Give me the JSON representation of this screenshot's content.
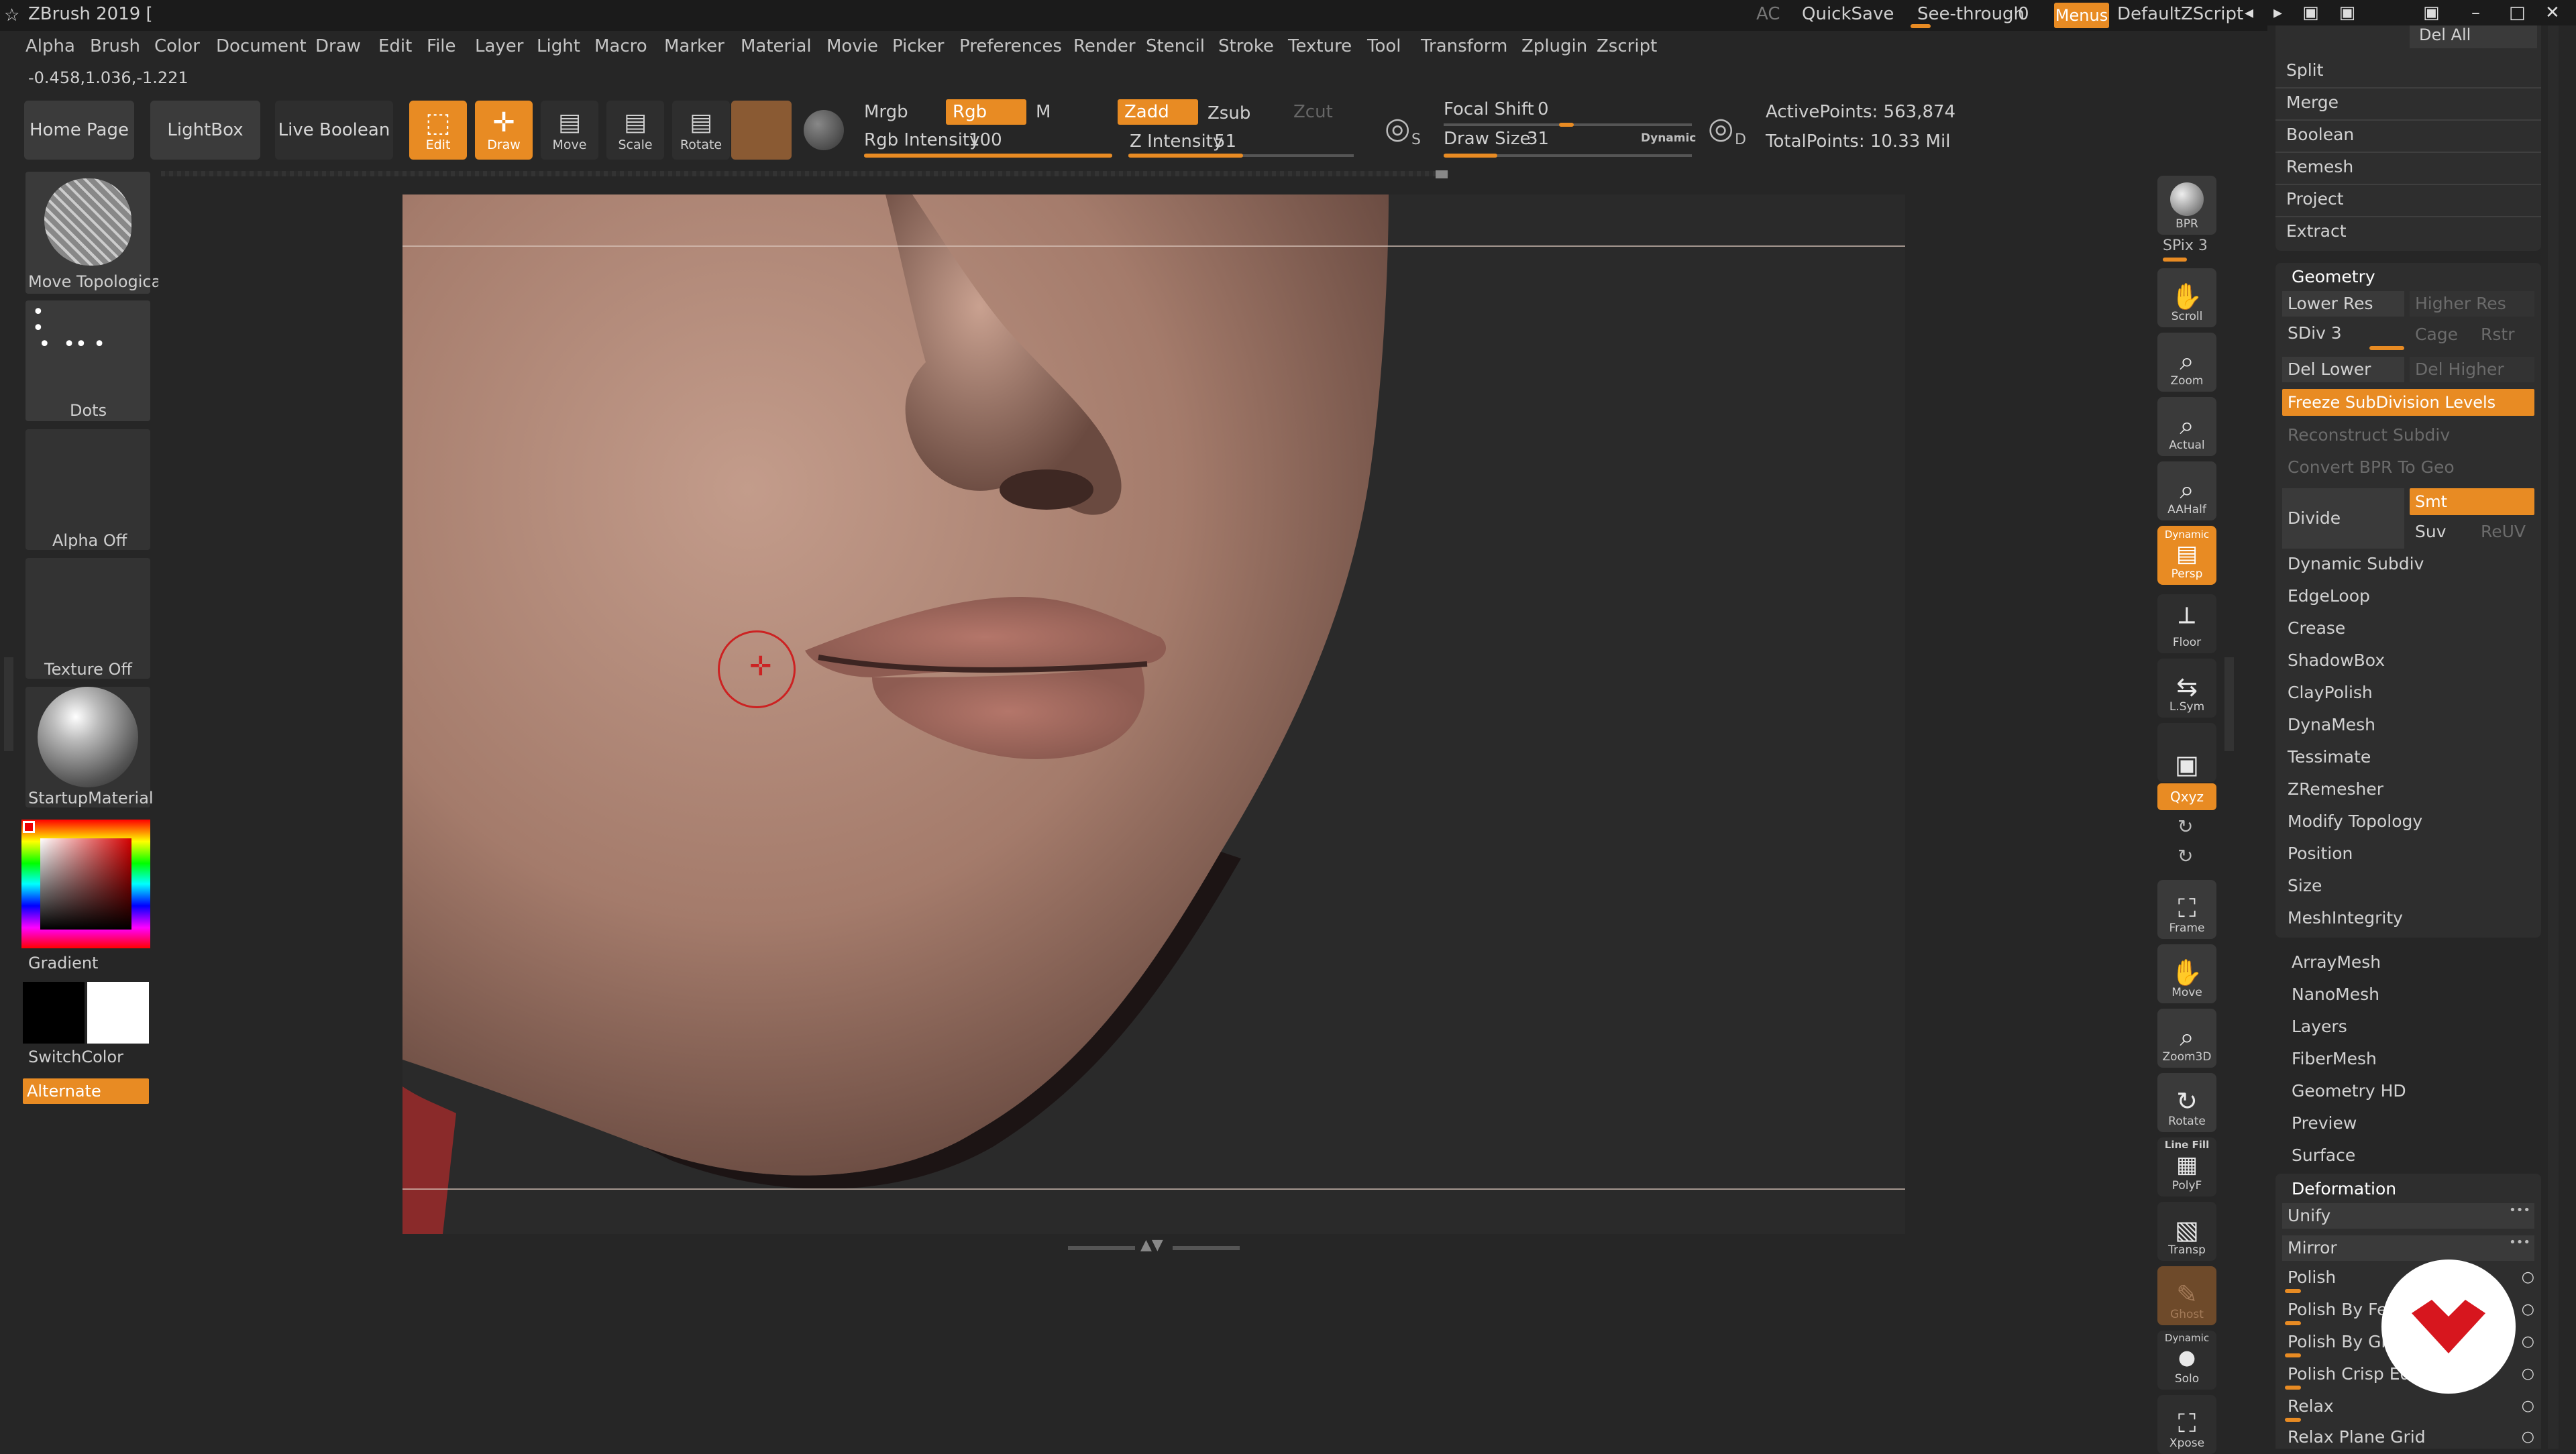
{
  "titlebar": {
    "app_title": "ZBrush 2019 [",
    "ac_label": "AC",
    "quicksave": "QuickSave",
    "see_through": "See-through",
    "see_through_value": "0",
    "menus": "Menus",
    "script": "DefaultZScript"
  },
  "menubar": [
    "Alpha",
    "Brush",
    "Color",
    "Document",
    "Draw",
    "Edit",
    "File",
    "Layer",
    "Light",
    "Macro",
    "Marker",
    "Material",
    "Movie",
    "Picker",
    "Preferences",
    "Render",
    "Stencil",
    "Stroke",
    "Texture",
    "Tool",
    "Transform",
    "Zplugin",
    "Zscript"
  ],
  "coords": "-0.458,1.036,-1.221",
  "toolbar": {
    "home_page": "Home Page",
    "lightbox": "LightBox",
    "live_boolean": "Live Boolean",
    "edit": "Edit",
    "draw": "Draw",
    "move": "Move",
    "scale": "Scale",
    "rotate": "Rotate",
    "mrgb": "Mrgb",
    "rgb": "Rgb",
    "m": "M",
    "zadd": "Zadd",
    "zsub": "Zsub",
    "zcut": "Zcut",
    "rgb_intensity_label": "Rgb Intensity",
    "rgb_intensity_value": "100",
    "rgb_intensity_level": 1.0,
    "z_intensity_label": "Z Intensity",
    "z_intensity_value": "51",
    "z_intensity_level": 0.51,
    "focal_shift_label": "Focal Shift",
    "focal_shift_value": "0",
    "draw_size_label": "Draw Size",
    "draw_size_value": "31",
    "dynamic": "Dynamic",
    "s_label": "S",
    "d_label": "D",
    "active_points": "ActivePoints: 563,874",
    "total_points": "TotalPoints: 10.33 Mil"
  },
  "left_shelf": {
    "brush": "Move Topologica",
    "stroke": "Dots",
    "alpha": "Alpha Off",
    "texture": "Texture Off",
    "material": "StartupMaterial",
    "gradient": "Gradient",
    "switchcolor": "SwitchColor",
    "alternate": "Alternate"
  },
  "right_shelf": {
    "bpr": "BPR",
    "spix": "SPix 3",
    "scroll": "Scroll",
    "zoom": "Zoom",
    "actual": "Actual",
    "aahalf": "AAHalf",
    "dynamic": "Dynamic",
    "persp": "Persp",
    "floor": "Floor",
    "lsym": "L.Sym",
    "xyz": "Qxyz",
    "frame": "Frame",
    "move": "Move",
    "zoom3d": "Zoom3D",
    "rotate": "Rotate",
    "linefill": "Line Fill",
    "polyf": "PolyF",
    "transp": "Transp",
    "ghost": "Ghost",
    "dynamic2": "Dynamic",
    "solo": "Solo",
    "xpose": "Xpose"
  },
  "subtool_panel": {
    "del_all": "Del All",
    "items": [
      "Split",
      "Merge",
      "Boolean",
      "Remesh",
      "Project",
      "Extract"
    ]
  },
  "geometry": {
    "header": "Geometry",
    "lower_res": "Lower Res",
    "higher_res": "Higher Res",
    "sdiv": "SDiv 3",
    "cage": "Cage",
    "rstr": "Rstr",
    "del_lower": "Del Lower",
    "del_higher": "Del Higher",
    "freeze": "Freeze SubDivision Levels",
    "reconstruct": "Reconstruct Subdiv",
    "convert_bpr": "Convert BPR To Geo",
    "divide": "Divide",
    "smt": "Smt",
    "suv": "Suv",
    "reuv": "ReUV",
    "sub_items": [
      "Dynamic Subdiv",
      "EdgeLoop",
      "Crease",
      "ShadowBox",
      "ClayPolish",
      "DynaMesh",
      "Tessimate",
      "ZRemesher",
      "Modify Topology",
      "Position",
      "Size",
      "MeshIntegrity"
    ]
  },
  "tool_sections": [
    "ArrayMesh",
    "NanoMesh",
    "Layers",
    "FiberMesh",
    "Geometry HD",
    "Preview",
    "Surface"
  ],
  "deformation": {
    "header": "Deformation",
    "items": [
      "Unify",
      "Mirror",
      "Polish",
      "Polish By Fea",
      "Polish By Gro",
      "Polish Crisp Edg",
      "Relax",
      "Relax Plane Grid"
    ]
  },
  "colors": {
    "accent": "#e88b23",
    "skin": "#b58a78",
    "background": "#262626"
  }
}
